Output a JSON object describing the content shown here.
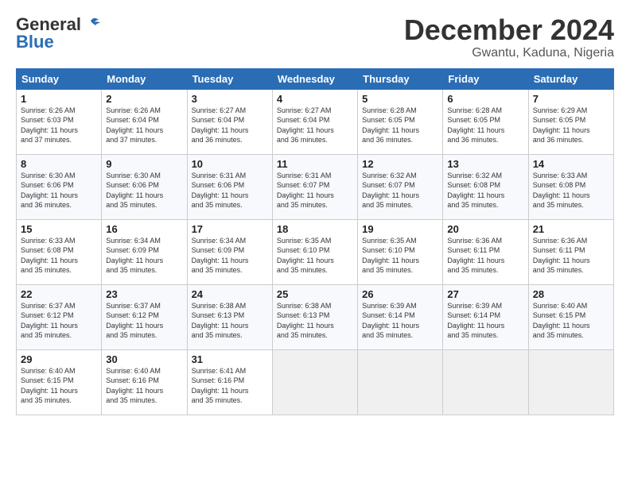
{
  "logo": {
    "line1": "General",
    "line2": "Blue"
  },
  "title": "December 2024",
  "location": "Gwantu, Kaduna, Nigeria",
  "days_of_week": [
    "Sunday",
    "Monday",
    "Tuesday",
    "Wednesday",
    "Thursday",
    "Friday",
    "Saturday"
  ],
  "weeks": [
    [
      {
        "day": "1",
        "info": "Sunrise: 6:26 AM\nSunset: 6:03 PM\nDaylight: 11 hours\nand 37 minutes."
      },
      {
        "day": "2",
        "info": "Sunrise: 6:26 AM\nSunset: 6:04 PM\nDaylight: 11 hours\nand 37 minutes."
      },
      {
        "day": "3",
        "info": "Sunrise: 6:27 AM\nSunset: 6:04 PM\nDaylight: 11 hours\nand 36 minutes."
      },
      {
        "day": "4",
        "info": "Sunrise: 6:27 AM\nSunset: 6:04 PM\nDaylight: 11 hours\nand 36 minutes."
      },
      {
        "day": "5",
        "info": "Sunrise: 6:28 AM\nSunset: 6:05 PM\nDaylight: 11 hours\nand 36 minutes."
      },
      {
        "day": "6",
        "info": "Sunrise: 6:28 AM\nSunset: 6:05 PM\nDaylight: 11 hours\nand 36 minutes."
      },
      {
        "day": "7",
        "info": "Sunrise: 6:29 AM\nSunset: 6:05 PM\nDaylight: 11 hours\nand 36 minutes."
      }
    ],
    [
      {
        "day": "8",
        "info": "Sunrise: 6:30 AM\nSunset: 6:06 PM\nDaylight: 11 hours\nand 36 minutes."
      },
      {
        "day": "9",
        "info": "Sunrise: 6:30 AM\nSunset: 6:06 PM\nDaylight: 11 hours\nand 35 minutes."
      },
      {
        "day": "10",
        "info": "Sunrise: 6:31 AM\nSunset: 6:06 PM\nDaylight: 11 hours\nand 35 minutes."
      },
      {
        "day": "11",
        "info": "Sunrise: 6:31 AM\nSunset: 6:07 PM\nDaylight: 11 hours\nand 35 minutes."
      },
      {
        "day": "12",
        "info": "Sunrise: 6:32 AM\nSunset: 6:07 PM\nDaylight: 11 hours\nand 35 minutes."
      },
      {
        "day": "13",
        "info": "Sunrise: 6:32 AM\nSunset: 6:08 PM\nDaylight: 11 hours\nand 35 minutes."
      },
      {
        "day": "14",
        "info": "Sunrise: 6:33 AM\nSunset: 6:08 PM\nDaylight: 11 hours\nand 35 minutes."
      }
    ],
    [
      {
        "day": "15",
        "info": "Sunrise: 6:33 AM\nSunset: 6:08 PM\nDaylight: 11 hours\nand 35 minutes."
      },
      {
        "day": "16",
        "info": "Sunrise: 6:34 AM\nSunset: 6:09 PM\nDaylight: 11 hours\nand 35 minutes."
      },
      {
        "day": "17",
        "info": "Sunrise: 6:34 AM\nSunset: 6:09 PM\nDaylight: 11 hours\nand 35 minutes."
      },
      {
        "day": "18",
        "info": "Sunrise: 6:35 AM\nSunset: 6:10 PM\nDaylight: 11 hours\nand 35 minutes."
      },
      {
        "day": "19",
        "info": "Sunrise: 6:35 AM\nSunset: 6:10 PM\nDaylight: 11 hours\nand 35 minutes."
      },
      {
        "day": "20",
        "info": "Sunrise: 6:36 AM\nSunset: 6:11 PM\nDaylight: 11 hours\nand 35 minutes."
      },
      {
        "day": "21",
        "info": "Sunrise: 6:36 AM\nSunset: 6:11 PM\nDaylight: 11 hours\nand 35 minutes."
      }
    ],
    [
      {
        "day": "22",
        "info": "Sunrise: 6:37 AM\nSunset: 6:12 PM\nDaylight: 11 hours\nand 35 minutes."
      },
      {
        "day": "23",
        "info": "Sunrise: 6:37 AM\nSunset: 6:12 PM\nDaylight: 11 hours\nand 35 minutes."
      },
      {
        "day": "24",
        "info": "Sunrise: 6:38 AM\nSunset: 6:13 PM\nDaylight: 11 hours\nand 35 minutes."
      },
      {
        "day": "25",
        "info": "Sunrise: 6:38 AM\nSunset: 6:13 PM\nDaylight: 11 hours\nand 35 minutes."
      },
      {
        "day": "26",
        "info": "Sunrise: 6:39 AM\nSunset: 6:14 PM\nDaylight: 11 hours\nand 35 minutes."
      },
      {
        "day": "27",
        "info": "Sunrise: 6:39 AM\nSunset: 6:14 PM\nDaylight: 11 hours\nand 35 minutes."
      },
      {
        "day": "28",
        "info": "Sunrise: 6:40 AM\nSunset: 6:15 PM\nDaylight: 11 hours\nand 35 minutes."
      }
    ],
    [
      {
        "day": "29",
        "info": "Sunrise: 6:40 AM\nSunset: 6:15 PM\nDaylight: 11 hours\nand 35 minutes."
      },
      {
        "day": "30",
        "info": "Sunrise: 6:40 AM\nSunset: 6:16 PM\nDaylight: 11 hours\nand 35 minutes."
      },
      {
        "day": "31",
        "info": "Sunrise: 6:41 AM\nSunset: 6:16 PM\nDaylight: 11 hours\nand 35 minutes."
      },
      null,
      null,
      null,
      null
    ]
  ]
}
